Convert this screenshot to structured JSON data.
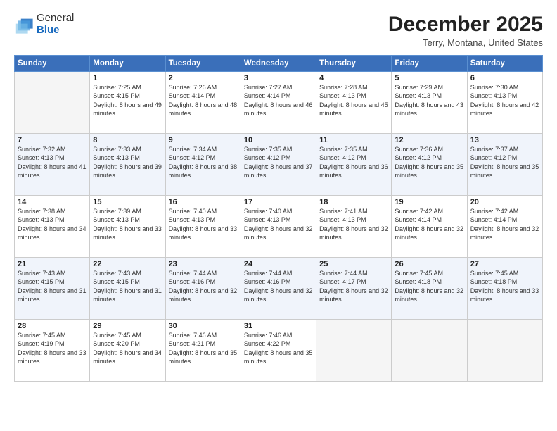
{
  "header": {
    "logo_general": "General",
    "logo_blue": "Blue",
    "month_title": "December 2025",
    "subtitle": "Terry, Montana, United States"
  },
  "days_of_week": [
    "Sunday",
    "Monday",
    "Tuesday",
    "Wednesday",
    "Thursday",
    "Friday",
    "Saturday"
  ],
  "weeks": [
    [
      {
        "num": "",
        "empty": true
      },
      {
        "num": "1",
        "sunrise": "7:25 AM",
        "sunset": "4:15 PM",
        "daylight": "8 hours and 49 minutes."
      },
      {
        "num": "2",
        "sunrise": "7:26 AM",
        "sunset": "4:14 PM",
        "daylight": "8 hours and 48 minutes."
      },
      {
        "num": "3",
        "sunrise": "7:27 AM",
        "sunset": "4:14 PM",
        "daylight": "8 hours and 46 minutes."
      },
      {
        "num": "4",
        "sunrise": "7:28 AM",
        "sunset": "4:13 PM",
        "daylight": "8 hours and 45 minutes."
      },
      {
        "num": "5",
        "sunrise": "7:29 AM",
        "sunset": "4:13 PM",
        "daylight": "8 hours and 43 minutes."
      },
      {
        "num": "6",
        "sunrise": "7:30 AM",
        "sunset": "4:13 PM",
        "daylight": "8 hours and 42 minutes."
      }
    ],
    [
      {
        "num": "7",
        "sunrise": "7:32 AM",
        "sunset": "4:13 PM",
        "daylight": "8 hours and 41 minutes."
      },
      {
        "num": "8",
        "sunrise": "7:33 AM",
        "sunset": "4:13 PM",
        "daylight": "8 hours and 39 minutes."
      },
      {
        "num": "9",
        "sunrise": "7:34 AM",
        "sunset": "4:12 PM",
        "daylight": "8 hours and 38 minutes."
      },
      {
        "num": "10",
        "sunrise": "7:35 AM",
        "sunset": "4:12 PM",
        "daylight": "8 hours and 37 minutes."
      },
      {
        "num": "11",
        "sunrise": "7:35 AM",
        "sunset": "4:12 PM",
        "daylight": "8 hours and 36 minutes."
      },
      {
        "num": "12",
        "sunrise": "7:36 AM",
        "sunset": "4:12 PM",
        "daylight": "8 hours and 35 minutes."
      },
      {
        "num": "13",
        "sunrise": "7:37 AM",
        "sunset": "4:12 PM",
        "daylight": "8 hours and 35 minutes."
      }
    ],
    [
      {
        "num": "14",
        "sunrise": "7:38 AM",
        "sunset": "4:13 PM",
        "daylight": "8 hours and 34 minutes."
      },
      {
        "num": "15",
        "sunrise": "7:39 AM",
        "sunset": "4:13 PM",
        "daylight": "8 hours and 33 minutes."
      },
      {
        "num": "16",
        "sunrise": "7:40 AM",
        "sunset": "4:13 PM",
        "daylight": "8 hours and 33 minutes."
      },
      {
        "num": "17",
        "sunrise": "7:40 AM",
        "sunset": "4:13 PM",
        "daylight": "8 hours and 32 minutes."
      },
      {
        "num": "18",
        "sunrise": "7:41 AM",
        "sunset": "4:13 PM",
        "daylight": "8 hours and 32 minutes."
      },
      {
        "num": "19",
        "sunrise": "7:42 AM",
        "sunset": "4:14 PM",
        "daylight": "8 hours and 32 minutes."
      },
      {
        "num": "20",
        "sunrise": "7:42 AM",
        "sunset": "4:14 PM",
        "daylight": "8 hours and 32 minutes."
      }
    ],
    [
      {
        "num": "21",
        "sunrise": "7:43 AM",
        "sunset": "4:15 PM",
        "daylight": "8 hours and 31 minutes."
      },
      {
        "num": "22",
        "sunrise": "7:43 AM",
        "sunset": "4:15 PM",
        "daylight": "8 hours and 31 minutes."
      },
      {
        "num": "23",
        "sunrise": "7:44 AM",
        "sunset": "4:16 PM",
        "daylight": "8 hours and 32 minutes."
      },
      {
        "num": "24",
        "sunrise": "7:44 AM",
        "sunset": "4:16 PM",
        "daylight": "8 hours and 32 minutes."
      },
      {
        "num": "25",
        "sunrise": "7:44 AM",
        "sunset": "4:17 PM",
        "daylight": "8 hours and 32 minutes."
      },
      {
        "num": "26",
        "sunrise": "7:45 AM",
        "sunset": "4:18 PM",
        "daylight": "8 hours and 32 minutes."
      },
      {
        "num": "27",
        "sunrise": "7:45 AM",
        "sunset": "4:18 PM",
        "daylight": "8 hours and 33 minutes."
      }
    ],
    [
      {
        "num": "28",
        "sunrise": "7:45 AM",
        "sunset": "4:19 PM",
        "daylight": "8 hours and 33 minutes."
      },
      {
        "num": "29",
        "sunrise": "7:45 AM",
        "sunset": "4:20 PM",
        "daylight": "8 hours and 34 minutes."
      },
      {
        "num": "30",
        "sunrise": "7:46 AM",
        "sunset": "4:21 PM",
        "daylight": "8 hours and 35 minutes."
      },
      {
        "num": "31",
        "sunrise": "7:46 AM",
        "sunset": "4:22 PM",
        "daylight": "8 hours and 35 minutes."
      },
      {
        "num": "",
        "empty": true
      },
      {
        "num": "",
        "empty": true
      },
      {
        "num": "",
        "empty": true
      }
    ]
  ]
}
